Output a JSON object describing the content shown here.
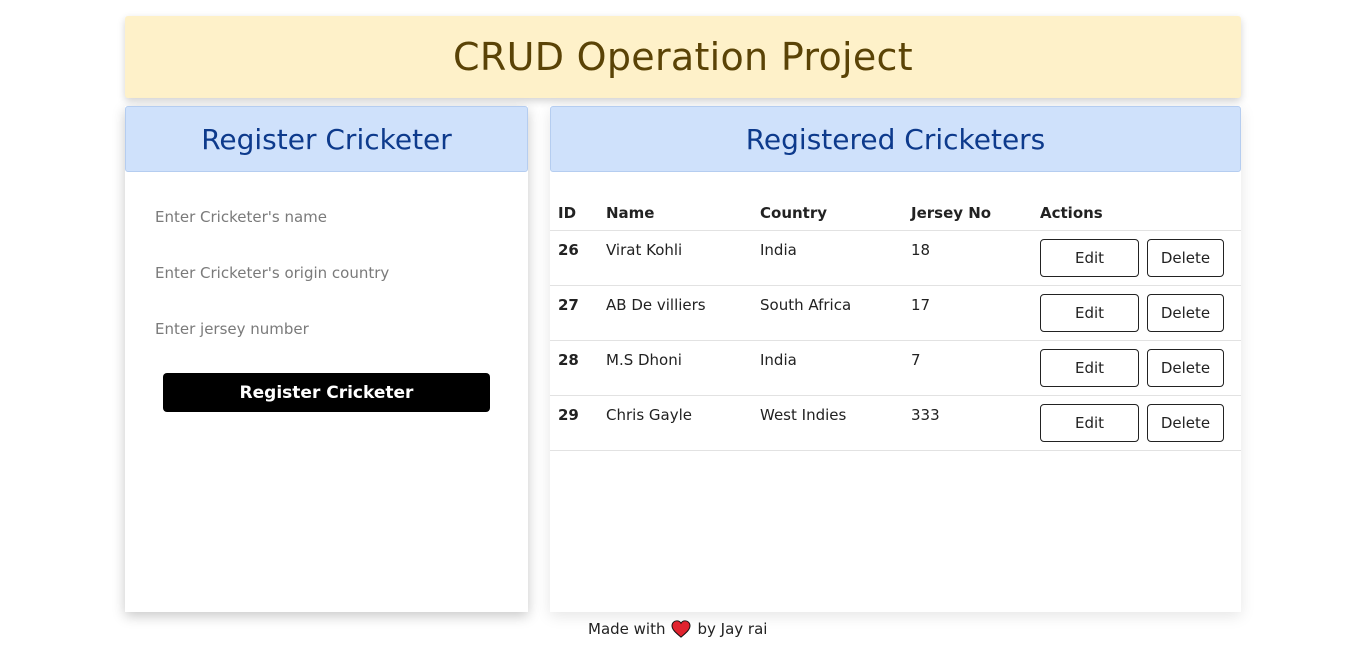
{
  "header": {
    "title": "CRUD Operation Project"
  },
  "register": {
    "title": "Register Cricketer",
    "name_placeholder": "Enter Cricketer's name",
    "country_placeholder": "Enter Cricketer's origin country",
    "jersey_placeholder": "Enter jersey number",
    "submit_label": "Register Cricketer"
  },
  "registered": {
    "title": "Registered Cricketers",
    "columns": [
      "ID",
      "Name",
      "Country",
      "Jersey No",
      "Actions"
    ],
    "rows": [
      {
        "id": "26",
        "name": "Virat Kohli",
        "country": "India",
        "jersey": "18",
        "edit": "Edit",
        "delete": "Delete"
      },
      {
        "id": "27",
        "name": "AB De villiers",
        "country": "South Africa",
        "jersey": "17",
        "edit": "Edit",
        "delete": "Delete"
      },
      {
        "id": "28",
        "name": "M.S Dhoni",
        "country": "India",
        "jersey": "7",
        "edit": "Edit",
        "delete": "Delete"
      },
      {
        "id": "29",
        "name": "Chris Gayle",
        "country": "West Indies",
        "jersey": "333",
        "edit": "Edit",
        "delete": "Delete"
      }
    ]
  },
  "footer": {
    "prefix": "Made with",
    "icon": "heart-icon",
    "suffix": "by Jay rai"
  },
  "colors": {
    "header_bg": "#fef1c9",
    "header_text": "#5a4306",
    "panel_head_bg": "#cfe1fb",
    "panel_head_text": "#0d3a8c",
    "primary_button": "#000000",
    "heart": "#e0232e"
  }
}
